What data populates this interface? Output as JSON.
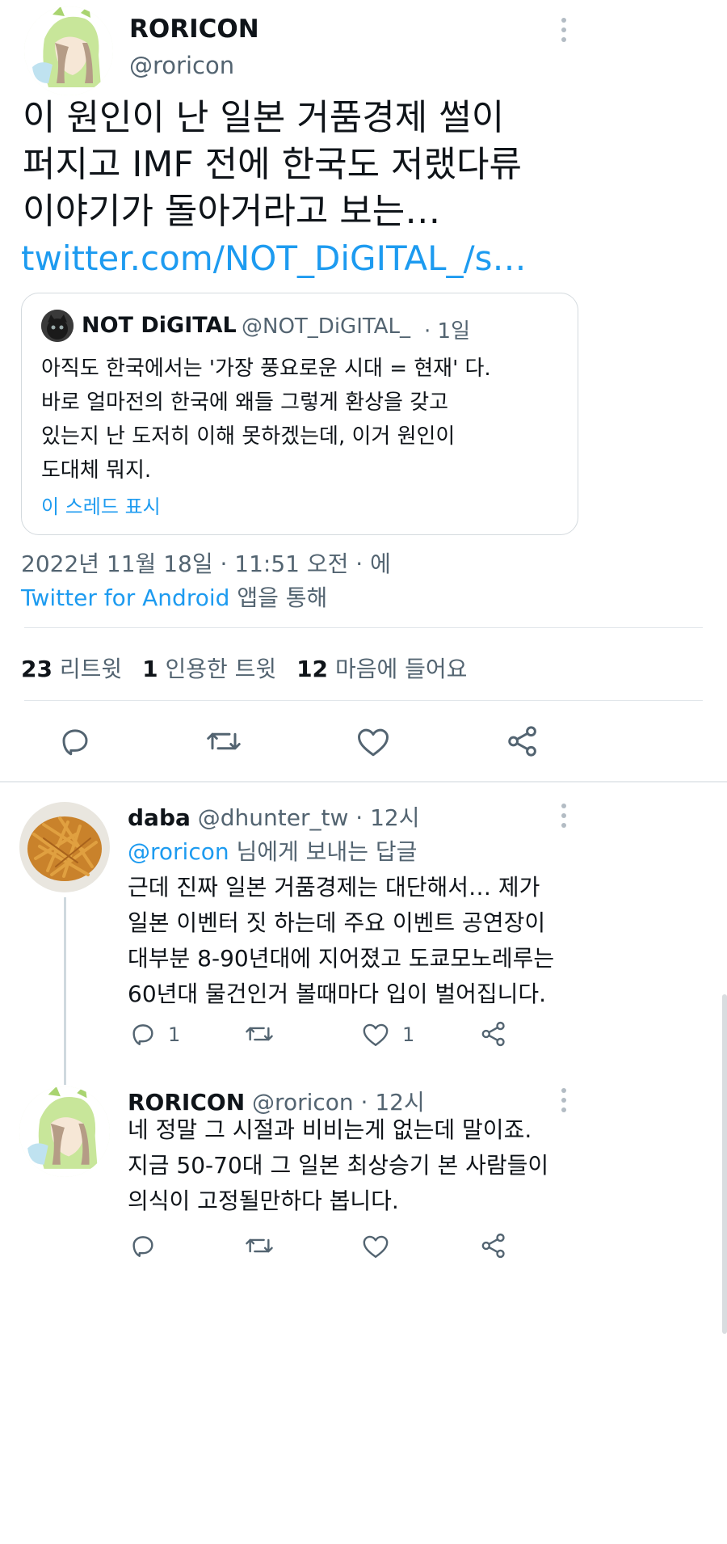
{
  "main_tweet": {
    "display_name": "RORICON",
    "handle": "@roricon",
    "text_lines": [
      "이 원인이 난 일본 거품경제 썰이",
      "퍼지고 IMF 전에 한국도 저랬다류",
      "이야기가 돌아거라고 보는…"
    ],
    "link": "twitter.com/NOT_DiGITAL_/s…",
    "timestamp": "2022년 11월 18일 · 11:51 오전 · 에",
    "client_link": "Twitter for Android",
    "client_suffix": "앱을 통해",
    "stats": {
      "retweets_count": "23",
      "retweets_label": "리트윗",
      "quotes_count": "1",
      "quotes_label": "인용한 트윗",
      "likes_count": "12",
      "likes_label": "마음에 들어요"
    }
  },
  "quoted_tweet": {
    "display_name": "NOT DiGITAL",
    "handle": "@NOT_DiGITAL_",
    "time": "· 1일",
    "text_lines": [
      "아직도 한국에서는 '가장 풍요로운 시대 = 현재' 다.",
      "바로 얼마전의 한국에 왜들 그렇게 환상을 갖고",
      "있는지 난 도저히 이해 못하겠는데, 이거 원인이",
      "도대체 뭐지."
    ],
    "show_thread": "이 스레드 표시"
  },
  "replies": [
    {
      "display_name": "daba",
      "handle": "@dhunter_tw",
      "time": "· 12시",
      "reply_to_handle": "@roricon",
      "reply_to_suffix": "님에게 보내는 답글",
      "text_lines": [
        "근데 진짜 일본 거품경제는 대단해서… 제가",
        "일본 이벤터 짓 하는데 주요 이벤트 공연장이",
        "대부분 8-90년대에 지어졌고 도쿄모노레루는",
        "60년대 물건인거 볼때마다 입이 벌어집니다."
      ],
      "reply_count": "1",
      "like_count": "1"
    },
    {
      "display_name": "RORICON",
      "handle": "@roricon",
      "time": "· 12시",
      "text_lines": [
        "네 정말 그 시절과 비비는게 없는데 말이죠.",
        "지금 50-70대 그 일본 최상승기 본 사람들이",
        "의식이 고정될만하다 봅니다."
      ]
    }
  ],
  "icons": {
    "reply": "reply-icon",
    "retweet": "retweet-icon",
    "like": "like-icon",
    "share": "share-icon",
    "more": "more-icon"
  },
  "colors": {
    "link": "#1d9bf0",
    "text": "#0f1419",
    "secondary": "#536471"
  }
}
